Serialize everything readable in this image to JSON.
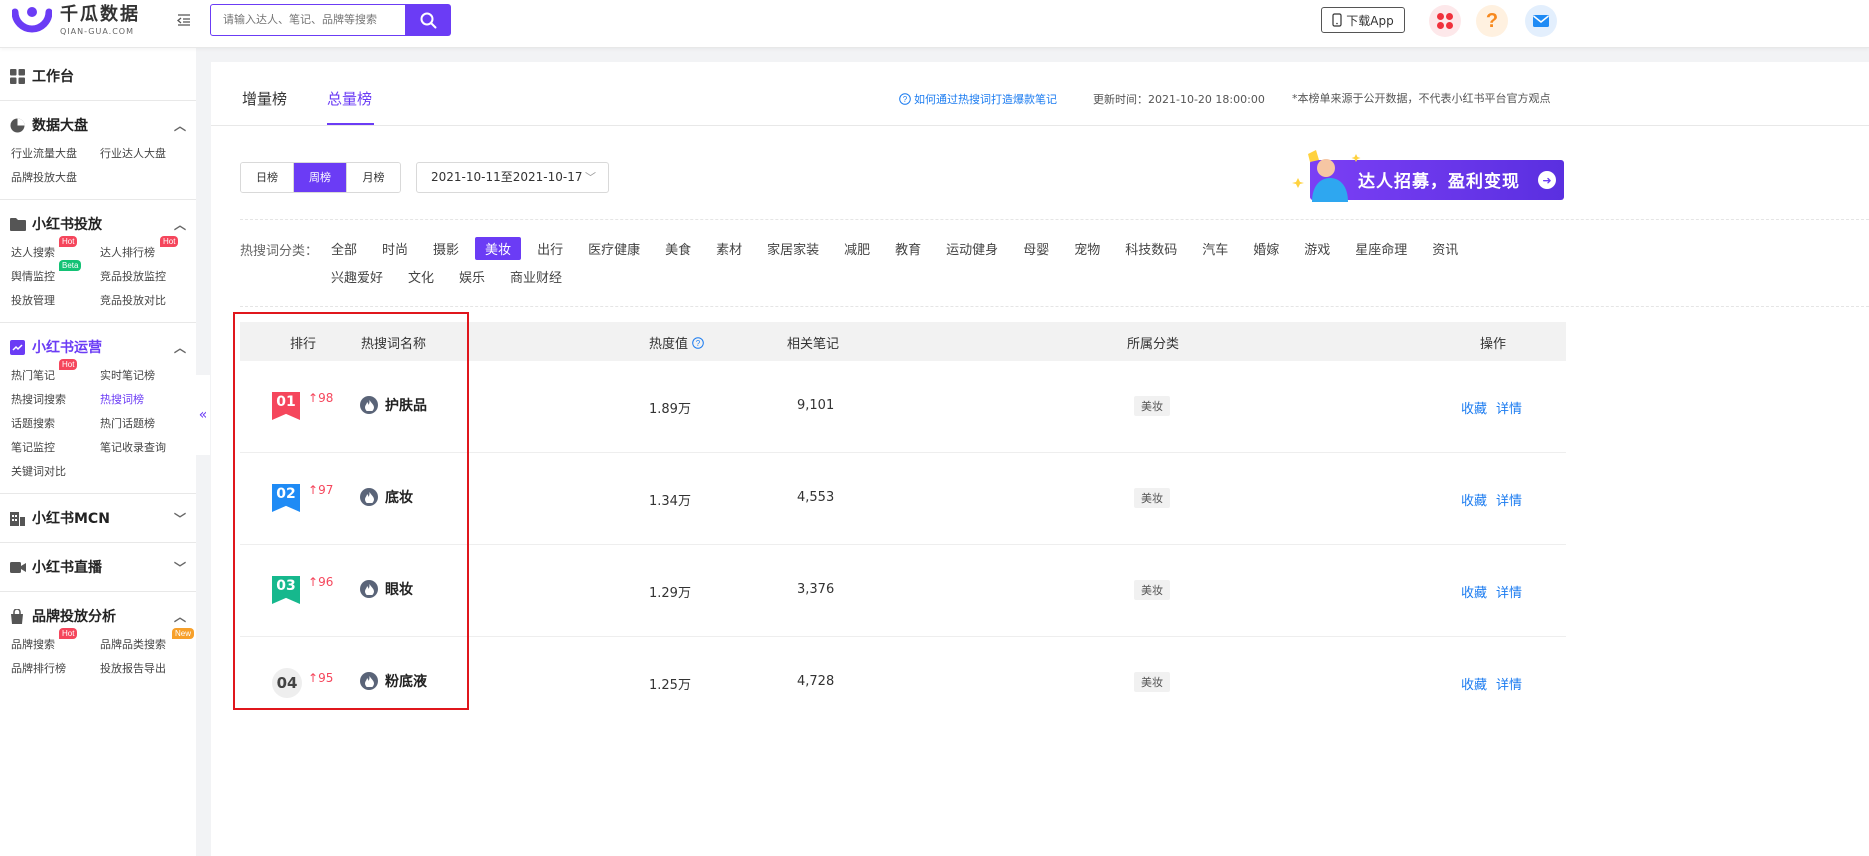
{
  "header": {
    "logo_title": "千瓜数据",
    "logo_sub": "QIAN-GUA.COM",
    "search_placeholder": "请输入达人、笔记、品牌等搜索",
    "download_label": "下载App"
  },
  "sidebar": {
    "workbench": "工作台",
    "sections": [
      {
        "title": "数据大盘",
        "items": [
          "行业流量大盘",
          "行业达人大盘",
          "品牌投放大盘"
        ]
      },
      {
        "title": "小红书投放",
        "items": [
          "达人搜索",
          "达人排行榜",
          "舆情监控",
          "竞品投放监控",
          "投放管理",
          "竞品投放对比"
        ]
      },
      {
        "title": "小红书运营",
        "items": [
          "热门笔记",
          "实时笔记榜",
          "热搜词搜索",
          "热搜词榜",
          "话题搜索",
          "热门话题榜",
          "笔记监控",
          "笔记收录查询",
          "关键词对比"
        ]
      },
      {
        "title": "小红书MCN"
      },
      {
        "title": "小红书直播"
      },
      {
        "title": "品牌投放分析",
        "items": [
          "品牌搜索",
          "品牌品类搜索",
          "品牌排行榜",
          "投放报告导出"
        ]
      }
    ],
    "badges": {
      "hot": "Hot",
      "beta": "Beta",
      "new": "New"
    }
  },
  "tabs": [
    "增量榜",
    "总量榜"
  ],
  "tips_link": "如何通过热搜词打造爆款笔记",
  "update_time": "更新时间：2021-10-20 18:00:00",
  "disclaimer": "*本榜单来源于公开数据，不代表小红书平台官方观点",
  "periods": [
    "日榜",
    "周榜",
    "月榜"
  ],
  "date_range": "2021-10-11至2021-10-17",
  "banner_text": "达人招募，盈利变现",
  "category_label": "热搜词分类：",
  "categories": [
    "全部",
    "时尚",
    "摄影",
    "美妆",
    "出行",
    "医疗健康",
    "美食",
    "素材",
    "家居家装",
    "减肥",
    "教育",
    "运动健身",
    "母婴",
    "宠物",
    "科技数码",
    "汽车",
    "婚嫁",
    "游戏",
    "星座命理",
    "资讯",
    "兴趣爱好",
    "文化",
    "娱乐",
    "商业财经"
  ],
  "active_category": "美妆",
  "table": {
    "headers": {
      "rank": "排行",
      "keyword": "热搜词名称",
      "heat": "热度值",
      "notes": "相关笔记",
      "category": "所属分类",
      "ops": "操作"
    },
    "rows": [
      {
        "rank": "01",
        "rise": "98",
        "keyword": "护肤品",
        "heat": "1.89万",
        "notes": "9,101",
        "category": "美妆",
        "fav": "收藏",
        "detail": "详情",
        "color": "#f5465c"
      },
      {
        "rank": "02",
        "rise": "97",
        "keyword": "底妆",
        "heat": "1.34万",
        "notes": "4,553",
        "category": "美妆",
        "fav": "收藏",
        "detail": "详情",
        "color": "#1f8bf5"
      },
      {
        "rank": "03",
        "rise": "96",
        "keyword": "眼妆",
        "heat": "1.29万",
        "notes": "3,376",
        "category": "美妆",
        "fav": "收藏",
        "detail": "详情",
        "color": "#16b88d"
      },
      {
        "rank": "04",
        "rise": "95",
        "keyword": "粉底液",
        "heat": "1.25万",
        "notes": "4,728",
        "category": "美妆",
        "fav": "收藏",
        "detail": "详情",
        "color": "#eeeeee"
      }
    ]
  },
  "colors": {
    "accent": "#6b3cf5",
    "link": "#1c7cf0",
    "rise": "#f5465c",
    "highlight": "#e0161c"
  }
}
